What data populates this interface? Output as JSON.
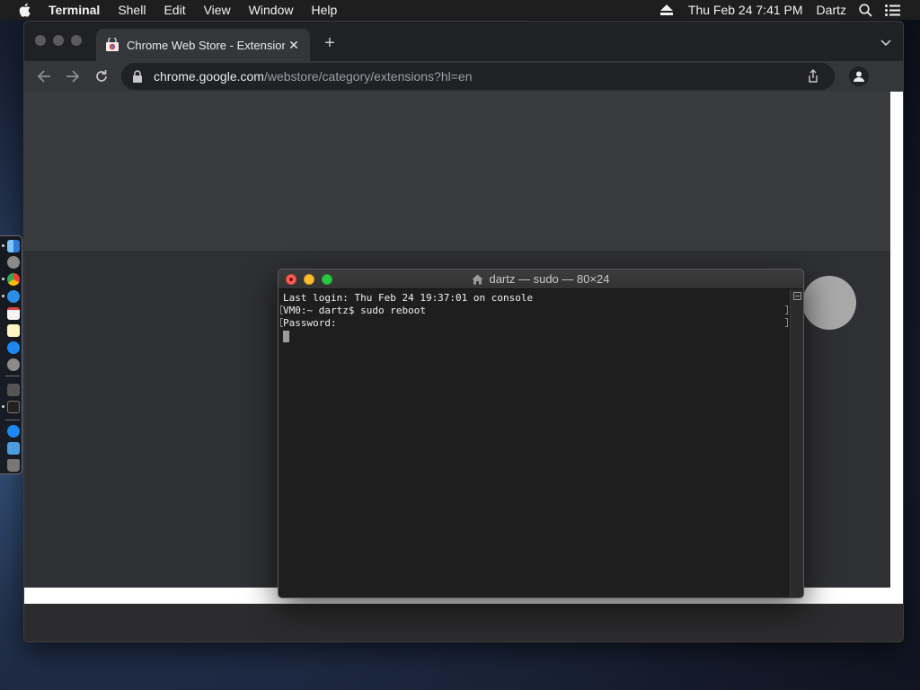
{
  "menubar": {
    "app_name": "Terminal",
    "items": [
      "Shell",
      "Edit",
      "View",
      "Window",
      "Help"
    ],
    "datetime": "Thu Feb 24  7:41 PM",
    "user": "Dartz",
    "icons": [
      "apple-icon",
      "eject-icon",
      "spotlight-search-icon",
      "control-center-icon"
    ]
  },
  "chrome": {
    "tab_title": "Chrome Web Store - Extension",
    "url_host": "chrome.google.com",
    "url_path": "/webstore/category/extensions?hl=en",
    "icons": [
      "webstore-favicon",
      "close-icon",
      "plus-icon",
      "back-icon",
      "forward-icon",
      "reload-icon",
      "lock-icon",
      "share-icon",
      "profile-icon",
      "chevron-down-icon"
    ]
  },
  "dock": {
    "apps": [
      "finder",
      "launchpad",
      "chrome",
      "safari",
      "calendar",
      "notes",
      "app-store",
      "system-preferences",
      "script-editor",
      "terminal",
      "app-store-2",
      "downloads-folder",
      "trash"
    ]
  },
  "terminal": {
    "title": "dartz — sudo — 80×24",
    "lines": [
      "Last login: Thu Feb 24 19:37:01 on console",
      "VM0:~ dartz$ sudo reboot",
      "Password:"
    ]
  },
  "colors": {
    "menubar_bg": "#1e1e1e",
    "chrome_tab_bg": "#35363a",
    "omnibox_bg": "#202124",
    "terminal_bg": "#1e1e1e",
    "close_red": "#fe5f57",
    "minimize_yellow": "#febc2e",
    "zoom_green": "#28c840"
  }
}
